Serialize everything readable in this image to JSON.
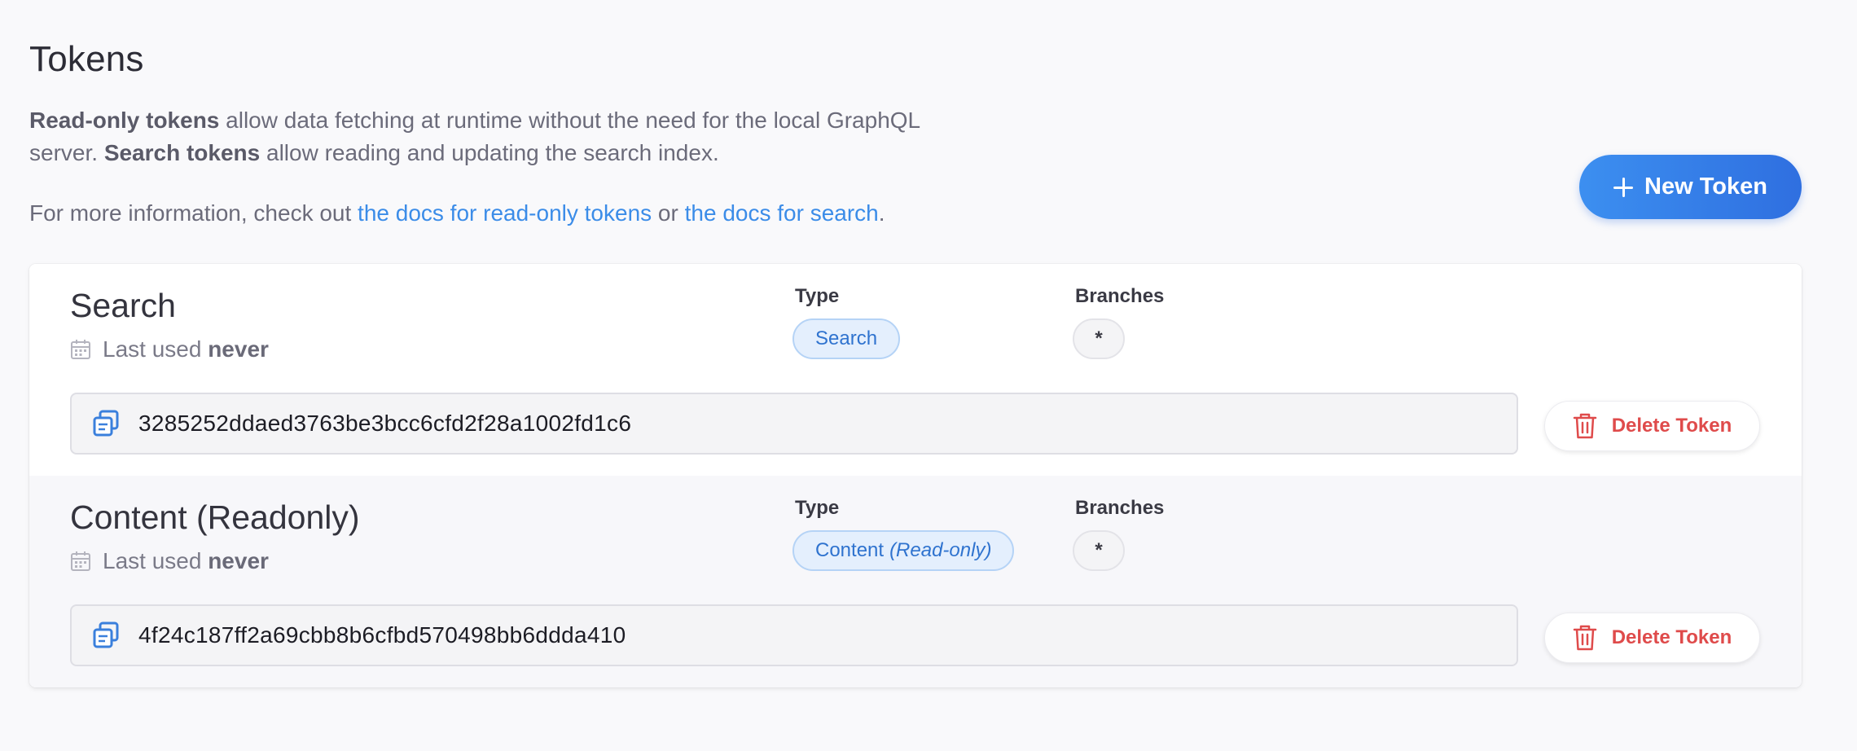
{
  "header": {
    "title": "Tokens",
    "desc_readonly_bold": "Read-only tokens",
    "desc_part1": " allow data fetching at runtime without the need for the local GraphQL server. ",
    "desc_search_bold": "Search tokens",
    "desc_part2": " allow reading and updating the search index.",
    "more_info_prefix": "For more information, check out ",
    "link_readonly_docs": "the docs for read-only tokens",
    "more_info_or": " or ",
    "link_search_docs": "the docs for search",
    "more_info_suffix": ".",
    "new_token_label": "New Token"
  },
  "columns": {
    "type": "Type",
    "branches": "Branches"
  },
  "tokens": [
    {
      "name": "Search",
      "last_used_prefix": "Last used ",
      "last_used_value": "never",
      "type_label": "Search",
      "type_suffix": "",
      "branches": "*",
      "value": "3285252ddaed3763be3bcc6cfd2f28a1002fd1c6",
      "delete_label": "Delete Token"
    },
    {
      "name": "Content (Readonly)",
      "last_used_prefix": "Last used ",
      "last_used_value": "never",
      "type_label": "Content",
      "type_suffix": "(Read-only)",
      "branches": "*",
      "value": "4f24c187ff2a69cbb8b6cfbd570498bb6ddda410",
      "delete_label": "Delete Token"
    }
  ],
  "colors": {
    "accent": "#3b8ce8",
    "danger": "#df4b4b",
    "badge_bg": "#e4effd"
  }
}
